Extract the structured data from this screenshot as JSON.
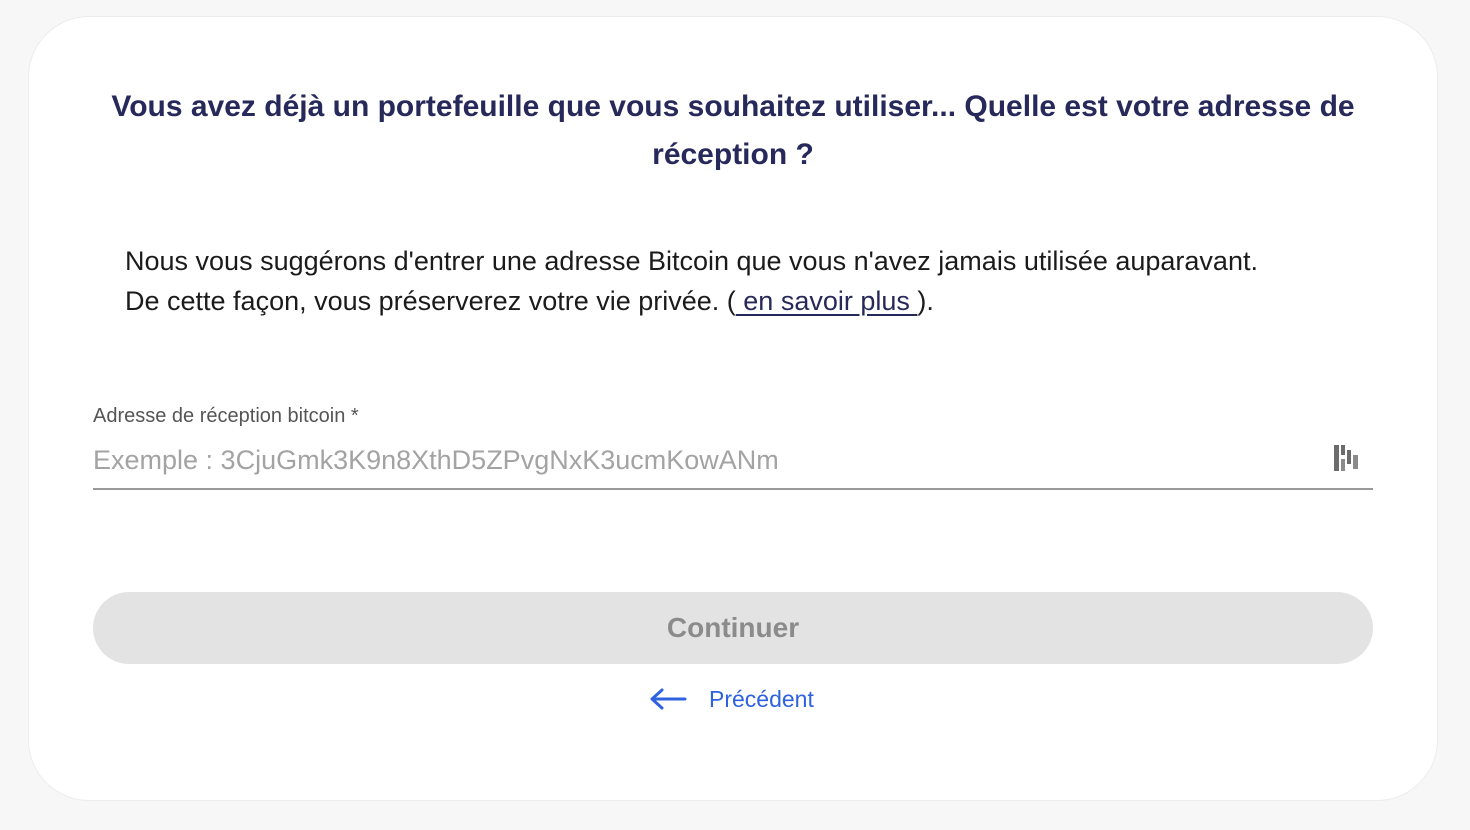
{
  "heading": "Vous avez déjà un portefeuille que vous souhaitez utiliser... Quelle est votre adresse de réception ?",
  "description": {
    "text": "Nous vous suggérons d'entrer une adresse Bitcoin que vous n'avez jamais utilisée auparavant. De cette façon, vous préserverez votre vie privée. (",
    "link_label": " en savoir plus ",
    "suffix": ")."
  },
  "address_field": {
    "label": "Adresse de réception bitcoin *",
    "placeholder": "Exemple : 3CjuGmk3K9n8XthD5ZPvgNxK3ucmKowANm",
    "value": "",
    "scan_icon": "qr-scan-icon"
  },
  "buttons": {
    "continue_label": "Continuer",
    "back_label": "Précédent",
    "back_icon": "arrow-left-icon"
  },
  "colors": {
    "heading": "#26295a",
    "link": "#26295a",
    "back_link": "#2f62e0",
    "button_disabled_bg": "#e3e3e3",
    "button_disabled_text": "#8b8b8b"
  }
}
